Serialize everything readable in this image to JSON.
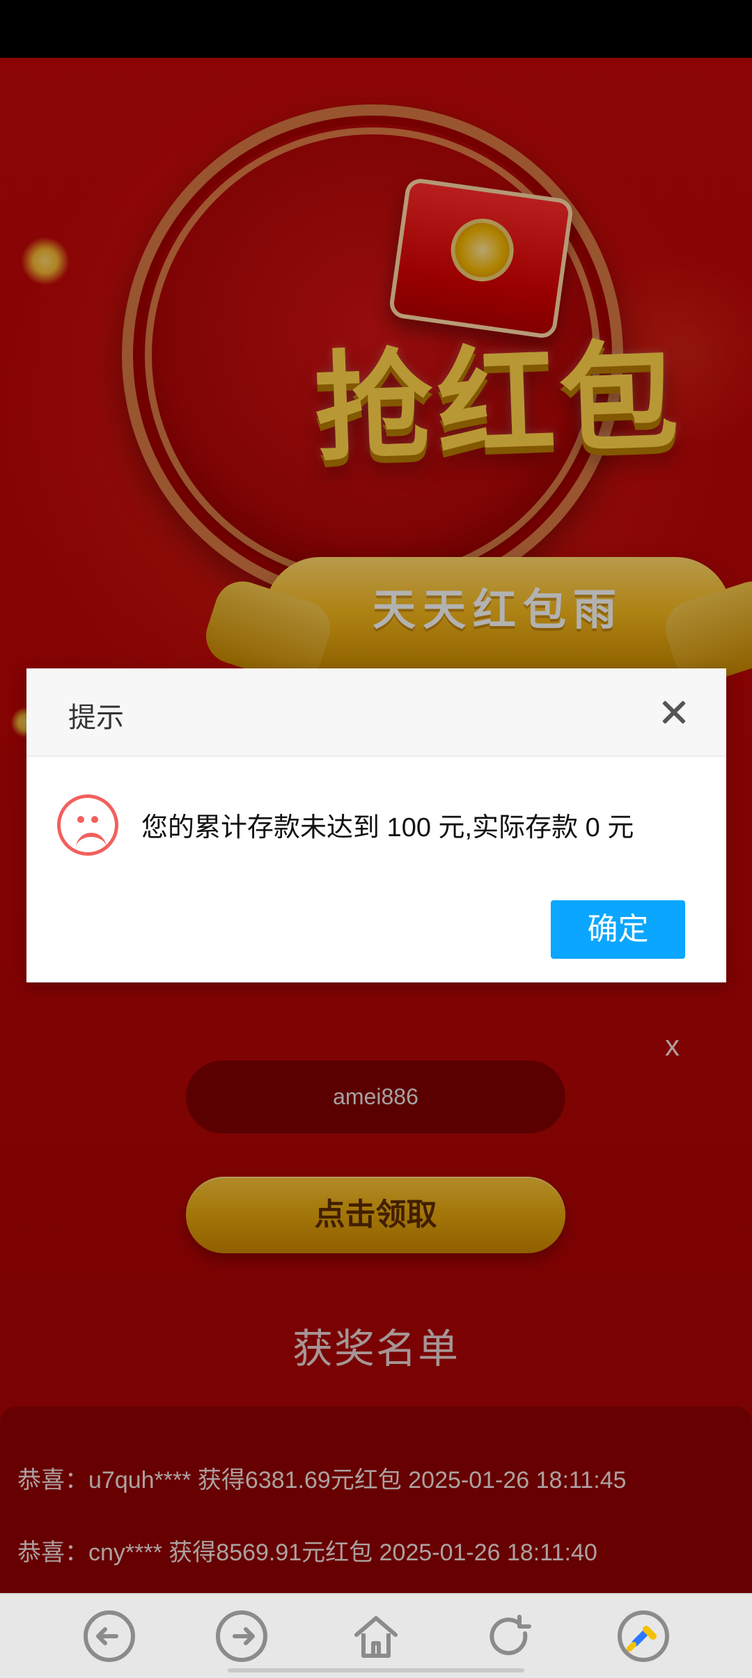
{
  "banner": {
    "title": "抢红包",
    "ribbon_text": "天天红包雨"
  },
  "dialog": {
    "title": "提示",
    "message": "您的累计存款未达到 100 元,实际存款 0 元",
    "confirm_label": "确定"
  },
  "page": {
    "close_label": "x",
    "username": "amei886",
    "claim_label": "点击领取",
    "winners_title": "获奖名单"
  },
  "winners": [
    {
      "text": "恭喜：u7quh**** 获得6381.69元红包 2025-01-26 18:11:45"
    },
    {
      "text": "恭喜：cny**** 获得8569.91元红包 2025-01-26 18:11:40"
    }
  ],
  "bottom_nav": {
    "icons": [
      "back-arrow-icon",
      "forward-arrow-icon",
      "home-icon",
      "refresh-icon",
      "cleanup-brush-icon"
    ]
  },
  "colors": {
    "primary_red": "#b60606",
    "dialog_button_blue": "#0aa6ff",
    "gold": "#f1b51b"
  }
}
